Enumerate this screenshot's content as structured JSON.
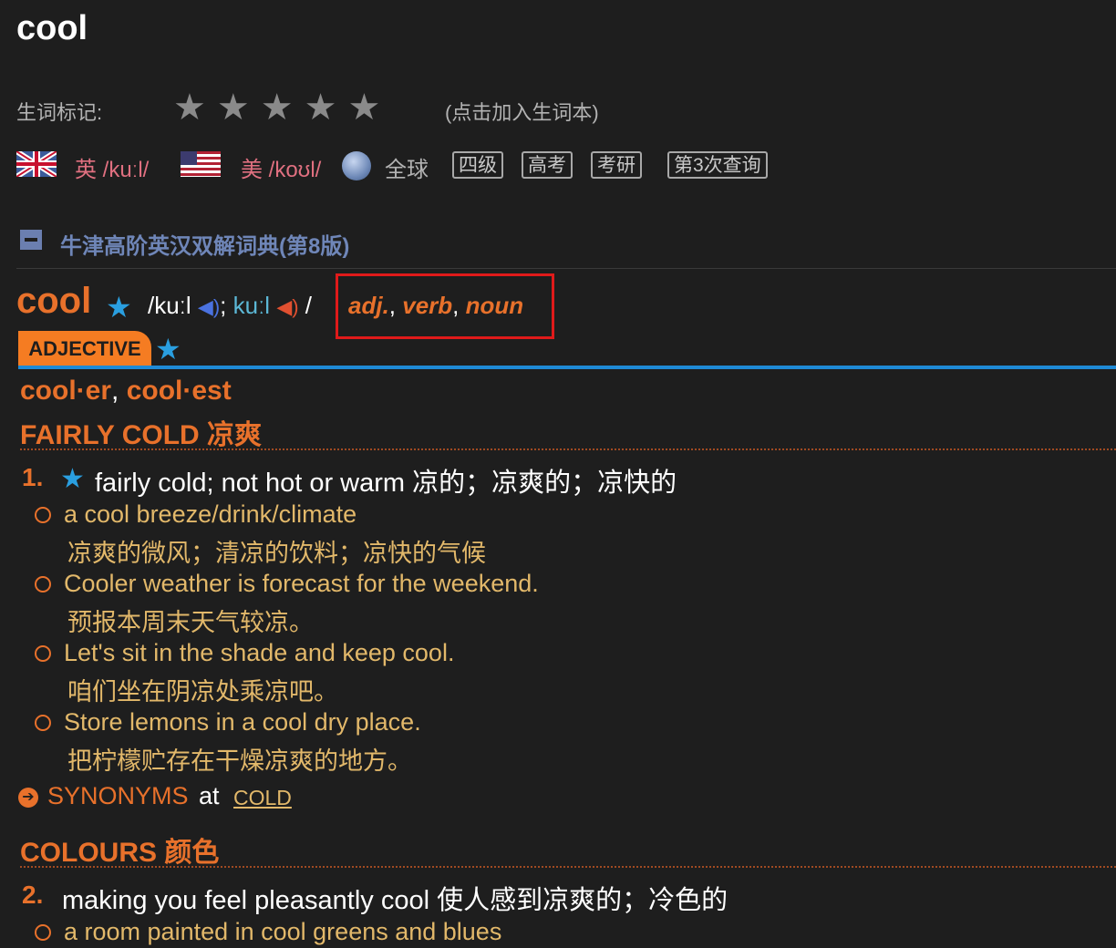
{
  "headword": "cool",
  "rating": {
    "label": "生词标记:",
    "stars": [
      "★",
      "★",
      "★",
      "★",
      "★"
    ],
    "hint": "(点击加入生词本)"
  },
  "pronunciation": {
    "uk": "英 /kuːl/",
    "us": "美 /koʊl/",
    "global": "全球"
  },
  "tags": [
    "四级",
    "高考",
    "考研",
    "第3次查询"
  ],
  "dictionary": {
    "name": "牛津高阶英汉双解词典(第8版)"
  },
  "entry": {
    "word": "cool",
    "star": "★",
    "phon_uk": "/kuːl",
    "phon_sep": "; ",
    "phon_us": "kuːl",
    "phon_end": " /",
    "speaker_icon": "◀)",
    "pos_adj": "adj.",
    "pos_verb": "verb",
    "pos_noun": "noun",
    "comma": ", "
  },
  "section": {
    "badge": "ADJECTIVE",
    "forms_1": "cool·er",
    "forms_comma": ", ",
    "forms_2": "cool·est",
    "shortcut_1": "FAIRLY COLD 凉爽",
    "shortcut_2": "COLOURS 颜色"
  },
  "senses": [
    {
      "num": "1.",
      "star": "★",
      "definition": "fairly cold; not hot or warm 凉的；凉爽的；凉快的",
      "examples": [
        {
          "en": "a cool breeze/drink/climate",
          "zh": "凉爽的微风；清凉的饮料；凉快的气候"
        },
        {
          "en": "Cooler weather is forecast for the weekend.",
          "zh": "预报本周末天气较凉。"
        },
        {
          "en": "Let's sit in the shade and keep cool.",
          "zh": "咱们坐在阴凉处乘凉吧。"
        },
        {
          "en": "Store lemons in a cool dry place.",
          "zh": "把柠檬贮存在干燥凉爽的地方。"
        }
      ]
    },
    {
      "num": "2.",
      "definition": "making you feel pleasantly cool 使人感到凉爽的；冷色的",
      "examples": [
        {
          "en": "a room painted in cool greens and blues"
        }
      ]
    }
  ],
  "synonyms": {
    "icon": "➔",
    "label": "SYNONYMS",
    "at": "at",
    "link": "COLD"
  },
  "colors": {
    "background": "#1e1e1e",
    "accent_orange": "#e8712b",
    "example_gold": "#e2b86a",
    "star_blue": "#2a9fe0",
    "highlight_red": "#e01a1a"
  }
}
